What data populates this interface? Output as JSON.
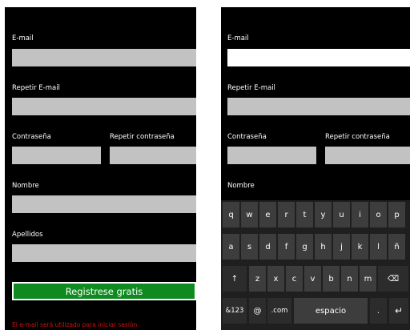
{
  "left": {
    "email_label": "E-mail",
    "repeat_email_label": "Repetir E-mail",
    "password_label": "Contraseña",
    "repeat_password_label": "Repetir contraseña",
    "name_label": "Nombre",
    "surname_label": "Apellidos",
    "register_button": "Registrese gratis",
    "note": "El e-mail será utilizado para iniciar sesión"
  },
  "right": {
    "email_label": "E-mail",
    "repeat_email_label": "Repetir E-mail",
    "password_label": "Contraseña",
    "repeat_password_label": "Repetir contraseña",
    "name_label": "Nombre"
  },
  "keyboard": {
    "row1": [
      "q",
      "w",
      "e",
      "r",
      "t",
      "y",
      "u",
      "i",
      "o",
      "p"
    ],
    "row2": [
      "a",
      "s",
      "d",
      "f",
      "g",
      "h",
      "j",
      "k",
      "l",
      "ñ"
    ],
    "row3": [
      "↑",
      "z",
      "x",
      "c",
      "v",
      "b",
      "n",
      "m",
      "⌫"
    ],
    "row4": [
      "&123",
      "@",
      ".com",
      "espacio",
      ".",
      "↵"
    ]
  },
  "colors": {
    "accent": "#0e8a1e",
    "note": "#d01010",
    "field": "#c2c2c2",
    "background": "#000000"
  }
}
